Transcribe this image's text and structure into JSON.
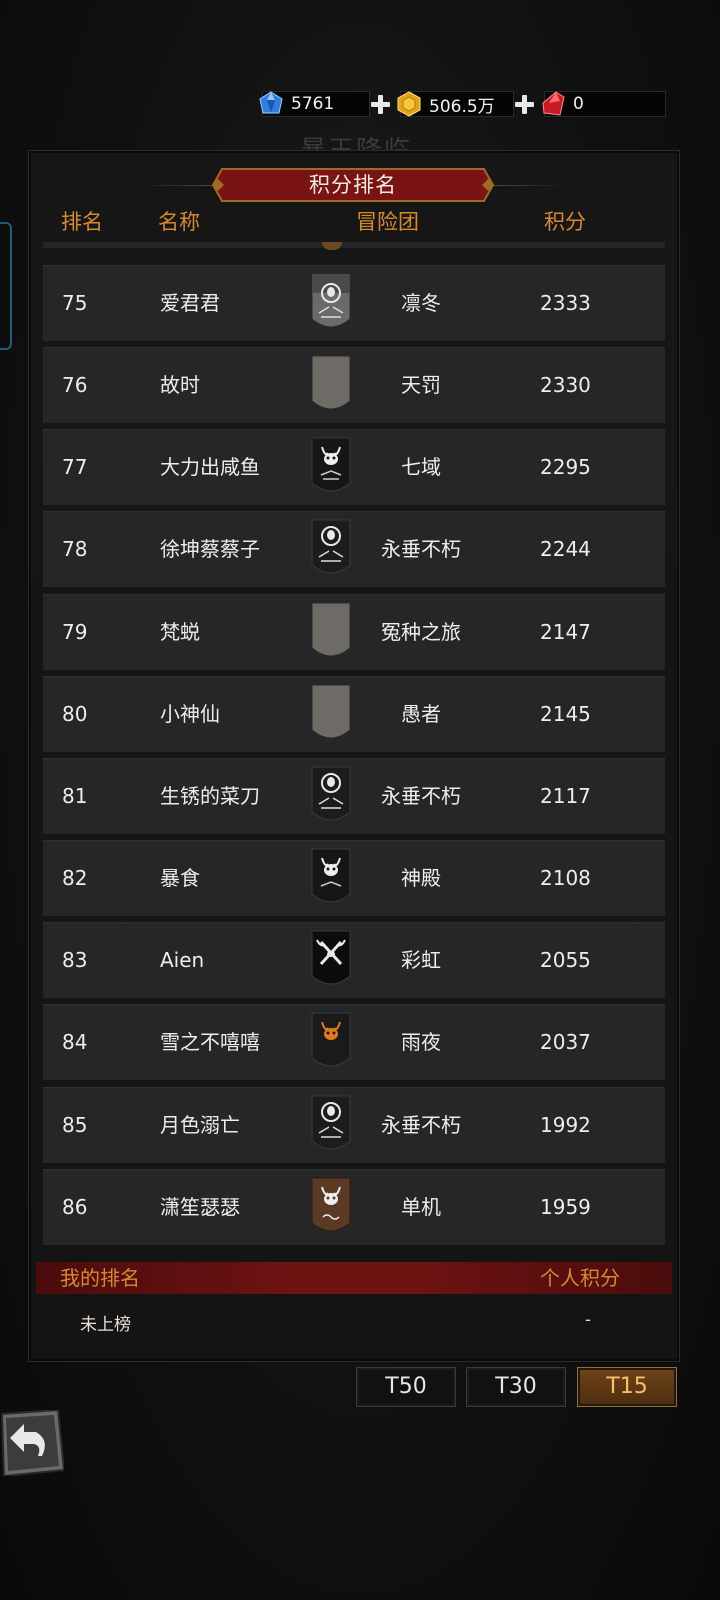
{
  "currency": {
    "blue_gem": "5761",
    "gold": "506.5万",
    "red_gem": "0"
  },
  "ghost_title": "暴王降临",
  "panel": {
    "title": "积分排名",
    "headers": {
      "rank": "排名",
      "name": "名称",
      "team": "冒险团",
      "score": "积分"
    }
  },
  "rows": [
    {
      "rank": "75",
      "name": "爱君君",
      "team": "凛冬",
      "score": "2333",
      "flag": "white-skull-flag"
    },
    {
      "rank": "76",
      "name": "故时",
      "team": "天罚",
      "score": "2330",
      "flag": "blank-gray-flag"
    },
    {
      "rank": "77",
      "name": "大力出咸鱼",
      "team": "七域",
      "score": "2295",
      "flag": "black-demon-flag"
    },
    {
      "rank": "78",
      "name": "徐坤蔡蔡子",
      "team": "永垂不朽",
      "score": "2244",
      "flag": "black-skull-flag"
    },
    {
      "rank": "79",
      "name": "梵蜕",
      "team": "冤种之旅",
      "score": "2147",
      "flag": "blank-gray-flag"
    },
    {
      "rank": "80",
      "name": "小神仙",
      "team": "愚者",
      "score": "2145",
      "flag": "blank-gray-flag"
    },
    {
      "rank": "81",
      "name": "生锈的菜刀",
      "team": "永垂不朽",
      "score": "2117",
      "flag": "black-skull-flag"
    },
    {
      "rank": "82",
      "name": "暴食",
      "team": "神殿",
      "score": "2108",
      "flag": "black-demon-flag"
    },
    {
      "rank": "83",
      "name": "Aien",
      "team": "彩虹",
      "score": "2055",
      "flag": "black-axe-flag"
    },
    {
      "rank": "84",
      "name": "雪之不嘻嘻",
      "team": "雨夜",
      "score": "2037",
      "flag": "orange-demon-flag"
    },
    {
      "rank": "85",
      "name": "月色溺亡",
      "team": "永垂不朽",
      "score": "1992",
      "flag": "black-skull-flag"
    },
    {
      "rank": "86",
      "name": "潇笙瑟瑟",
      "team": "单机",
      "score": "1959",
      "flag": "brown-demon-flag"
    }
  ],
  "my_rank": {
    "label": "我的排名",
    "score_label": "个人积分",
    "rank_value": "未上榜",
    "score_value": "-"
  },
  "tabs": [
    {
      "label": "T50",
      "active": false
    },
    {
      "label": "T30",
      "active": false
    },
    {
      "label": "T15",
      "active": true
    }
  ],
  "colors": {
    "accent": "#d88a2a",
    "banner": "#7a1414",
    "row_bg": "#262626",
    "active_tab": "#6e4418"
  }
}
